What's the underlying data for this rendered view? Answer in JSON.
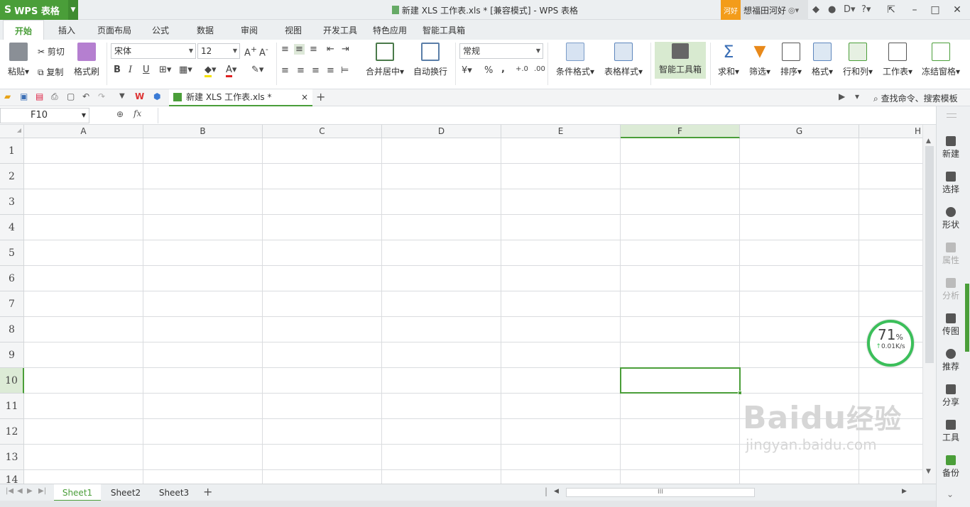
{
  "app": {
    "logo_text": "S",
    "name": "WPS 表格",
    "window_title": "新建 XLS 工作表.xls * [兼容模式] - WPS 表格"
  },
  "user": {
    "badge": "河好",
    "name": "想福田河好"
  },
  "title_icons": [
    "skin-icon",
    "settings-icon",
    "help-icon"
  ],
  "ribbon_tabs": [
    "开始",
    "插入",
    "页面布局",
    "公式",
    "数据",
    "审阅",
    "视图",
    "开发工具",
    "特色应用",
    "智能工具箱"
  ],
  "active_tab": "开始",
  "ribbon": {
    "paste": "粘贴",
    "cut": "剪切",
    "copy": "复制",
    "format_painter": "格式刷",
    "font_name": "宋体",
    "font_size": "12",
    "merge_center": "合并居中",
    "wrap_text": "自动换行",
    "number_format": "常规",
    "percent": "%",
    "comma": ",",
    "conditional_format": "条件格式",
    "table_style": "表格样式",
    "smart_toolbox": "智能工具箱",
    "sum": "求和",
    "filter": "筛选",
    "sort": "排序",
    "format": "格式",
    "rows_cols": "行和列",
    "worksheet": "工作表",
    "freeze_panes": "冻结窗格",
    "bold": "B",
    "italic": "I",
    "underline": "U"
  },
  "doc_tab": {
    "label": "新建 XLS 工作表.xls *",
    "close": "×",
    "add": "+"
  },
  "search": {
    "label": "查找命令、搜索模板"
  },
  "formula_bar": {
    "name_box": "F10",
    "fx": "fx"
  },
  "columns": [
    "A",
    "B",
    "C",
    "D",
    "E",
    "F",
    "G",
    "H"
  ],
  "selected_column": "F",
  "rows": [
    "1",
    "2",
    "3",
    "4",
    "5",
    "6",
    "7",
    "8",
    "9",
    "10",
    "11",
    "12",
    "13",
    "14"
  ],
  "selected_row": "10",
  "selected_cell": "F10",
  "sheets": [
    "Sheet1",
    "Sheet2",
    "Sheet3"
  ],
  "active_sheet": "Sheet1",
  "side_panel": [
    {
      "label": "新建",
      "icon": "new-doc-icon",
      "enabled": true
    },
    {
      "label": "选择",
      "icon": "select-icon",
      "enabled": true
    },
    {
      "label": "形状",
      "icon": "shape-icon",
      "enabled": true
    },
    {
      "label": "属性",
      "icon": "property-icon",
      "enabled": false
    },
    {
      "label": "分析",
      "icon": "analysis-icon",
      "enabled": false
    },
    {
      "label": "传图",
      "icon": "upload-image-icon",
      "enabled": true
    },
    {
      "label": "推荐",
      "icon": "recommend-icon",
      "enabled": true
    },
    {
      "label": "分享",
      "icon": "share-icon",
      "enabled": true
    },
    {
      "label": "工具",
      "icon": "toolbox-icon",
      "enabled": true
    },
    {
      "label": "备份",
      "icon": "backup-icon",
      "enabled": true
    }
  ],
  "speed_widget": {
    "percent": "71",
    "unit": "%",
    "rate": "0.01K/s"
  },
  "watermark": {
    "brand": "Baidu",
    "cn": "经验",
    "url": "jingyan.baidu.com"
  },
  "colors": {
    "accent": "#4a9e39",
    "user_badge": "#f39c1a",
    "speed_ring": "#3bbf5a"
  }
}
